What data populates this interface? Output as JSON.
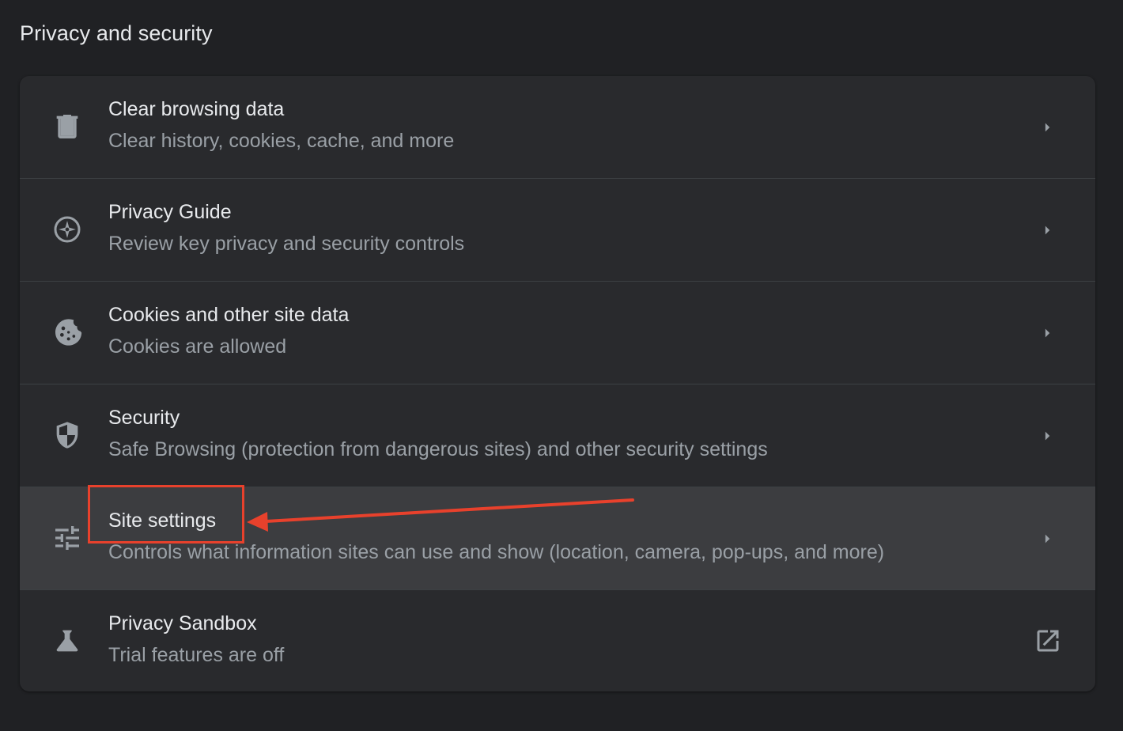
{
  "section": {
    "title": "Privacy and security"
  },
  "rows": [
    {
      "title": "Clear browsing data",
      "subtitle": "Clear history, cookies, cache, and more",
      "icon": "trash-icon",
      "action": "chevron-right-icon"
    },
    {
      "title": "Privacy Guide",
      "subtitle": "Review key privacy and security controls",
      "icon": "compass-icon",
      "action": "chevron-right-icon"
    },
    {
      "title": "Cookies and other site data",
      "subtitle": "Cookies are allowed",
      "icon": "cookie-icon",
      "action": "chevron-right-icon"
    },
    {
      "title": "Security",
      "subtitle": "Safe Browsing (protection from dangerous sites) and other security settings",
      "icon": "shield-icon",
      "action": "chevron-right-icon"
    },
    {
      "title": "Site settings",
      "subtitle": "Controls what information sites can use and show (location, camera, pop-ups, and more)",
      "icon": "tune-icon",
      "action": "chevron-right-icon",
      "hovered": true
    },
    {
      "title": "Privacy Sandbox",
      "subtitle": "Trial features are off",
      "icon": "flask-icon",
      "action": "open-external-icon"
    }
  ],
  "annotation": {
    "highlight_color": "#e8412c"
  },
  "colors": {
    "background": "#202124",
    "card": "#292a2d",
    "hover_row": "#3c3d40",
    "title_text": "#e8eaed",
    "secondary_text": "#9aa0a6",
    "icon": "#9aa0a6"
  }
}
